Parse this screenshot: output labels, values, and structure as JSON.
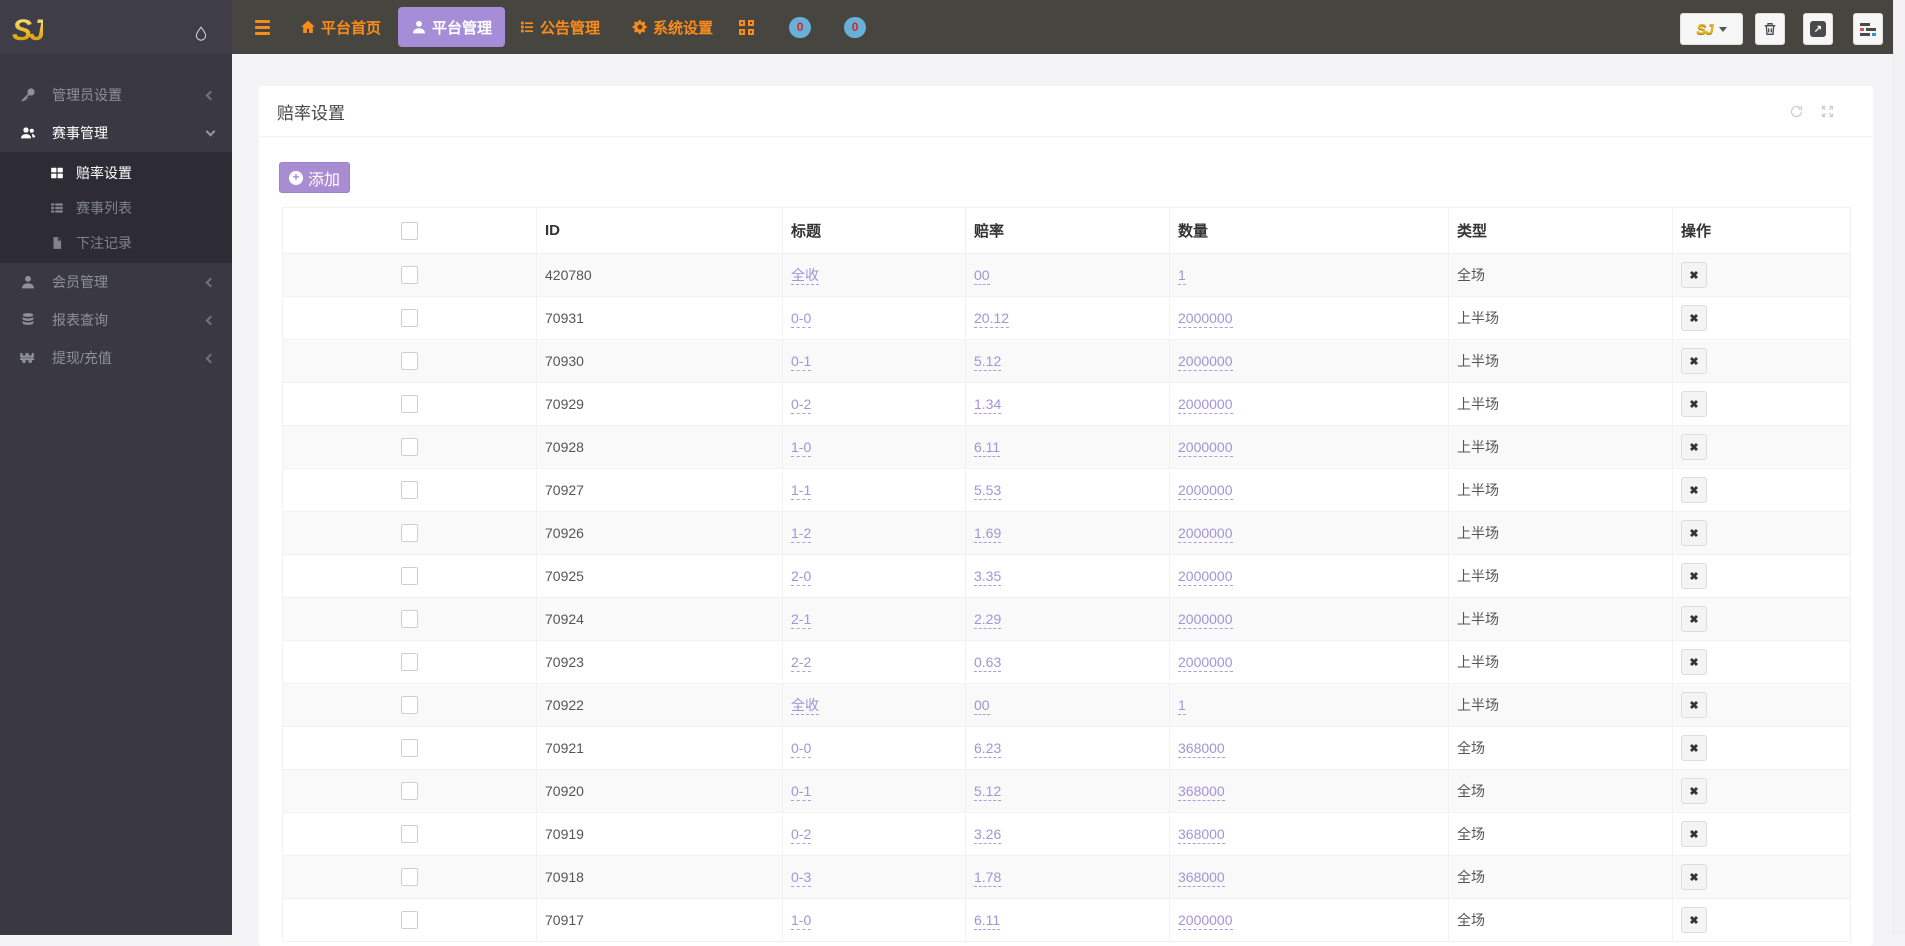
{
  "navbar": {
    "menu": [
      {
        "label": "平台首页",
        "icon": "home",
        "active": false
      },
      {
        "label": "平台管理",
        "icon": "user",
        "active": true
      },
      {
        "label": "公告管理",
        "icon": "announcement",
        "active": false
      },
      {
        "label": "系统设置",
        "icon": "gear",
        "active": false
      }
    ],
    "badges": [
      {
        "count": "0"
      },
      {
        "count": "0"
      }
    ],
    "logo_button_label": "SJ"
  },
  "sidebar": {
    "logo": "SJ",
    "menu": [
      {
        "label": "管理员设置",
        "icon": "key",
        "state": "collapsed",
        "active": false
      },
      {
        "label": "赛事管理",
        "icon": "users",
        "state": "expanded",
        "active": true,
        "children": [
          {
            "label": "赔率设置",
            "icon": "th-large",
            "active": true
          },
          {
            "label": "赛事列表",
            "icon": "th-list",
            "active": false
          },
          {
            "label": "下注记录",
            "icon": "file",
            "active": false
          }
        ]
      },
      {
        "label": "会员管理",
        "icon": "user",
        "state": "collapsed",
        "active": false
      },
      {
        "label": "报表查询",
        "icon": "database",
        "state": "collapsed",
        "active": false
      },
      {
        "label": "提现/充值",
        "icon": "won",
        "state": "collapsed",
        "active": false
      }
    ]
  },
  "panel": {
    "title": "赔率设置",
    "add_button_label": "添加",
    "table": {
      "headers": [
        "",
        "ID",
        "标题",
        "赔率",
        "数量",
        "类型",
        "操作"
      ],
      "rows": [
        {
          "id": "420780",
          "title": "全收",
          "odds": "00",
          "amount": "1",
          "type": "全场"
        },
        {
          "id": "70931",
          "title": "0-0",
          "odds": "20.12",
          "amount": "2000000",
          "type": "上半场"
        },
        {
          "id": "70930",
          "title": "0-1",
          "odds": "5.12",
          "amount": "2000000",
          "type": "上半场"
        },
        {
          "id": "70929",
          "title": "0-2",
          "odds": "1.34",
          "amount": "2000000",
          "type": "上半场"
        },
        {
          "id": "70928",
          "title": "1-0",
          "odds": "6.11",
          "amount": "2000000",
          "type": "上半场"
        },
        {
          "id": "70927",
          "title": "1-1",
          "odds": "5.53",
          "amount": "2000000",
          "type": "上半场"
        },
        {
          "id": "70926",
          "title": "1-2",
          "odds": "1.69",
          "amount": "2000000",
          "type": "上半场"
        },
        {
          "id": "70925",
          "title": "2-0",
          "odds": "3.35",
          "amount": "2000000",
          "type": "上半场"
        },
        {
          "id": "70924",
          "title": "2-1",
          "odds": "2.29",
          "amount": "2000000",
          "type": "上半场"
        },
        {
          "id": "70923",
          "title": "2-2",
          "odds": "0.63",
          "amount": "2000000",
          "type": "上半场"
        },
        {
          "id": "70922",
          "title": "全收",
          "odds": "00",
          "amount": "1",
          "type": "上半场"
        },
        {
          "id": "70921",
          "title": "0-0",
          "odds": "6.23",
          "amount": "368000",
          "type": "全场"
        },
        {
          "id": "70920",
          "title": "0-1",
          "odds": "5.12",
          "amount": "368000",
          "type": "全场"
        },
        {
          "id": "70919",
          "title": "0-2",
          "odds": "3.26",
          "amount": "368000",
          "type": "全场"
        },
        {
          "id": "70918",
          "title": "0-3",
          "odds": "1.78",
          "amount": "368000",
          "type": "全场"
        },
        {
          "id": "70917",
          "title": "1-0",
          "odds": "6.11",
          "amount": "2000000",
          "type": "全场"
        }
      ]
    }
  },
  "colors": {
    "accent_orange": "#fb8c1a",
    "accent_purple": "#a58ed7",
    "button_purple": "#a98dd3",
    "link_purple": "#a394d7",
    "badge_blue": "#67b1d8",
    "badge_text_red": "#e21f1f"
  }
}
